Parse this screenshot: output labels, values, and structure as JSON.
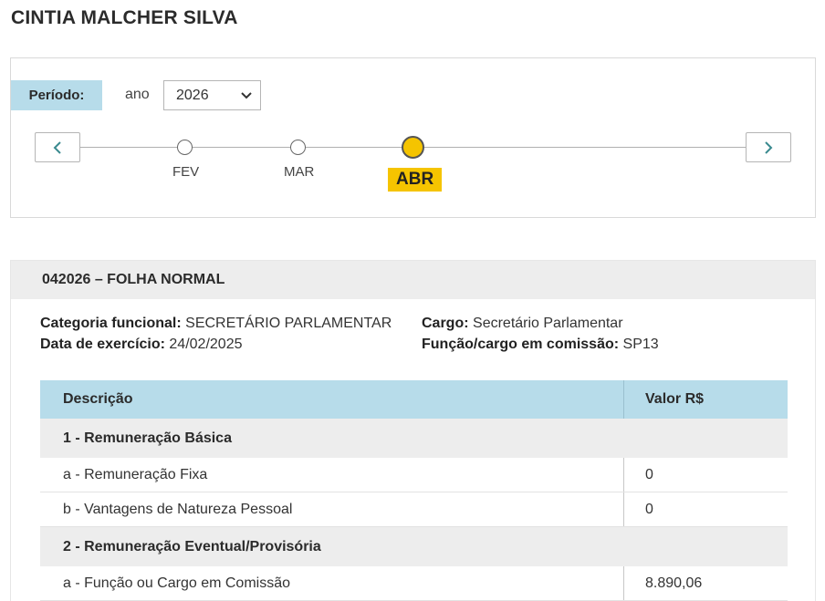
{
  "page": {
    "title": "CINTIA MALCHER SILVA"
  },
  "periodo": {
    "label": "Período:",
    "ano_label": "ano",
    "year_selected": "2026",
    "months": [
      {
        "label": "FEV",
        "selected": false
      },
      {
        "label": "MAR",
        "selected": false
      },
      {
        "label": "ABR",
        "selected": true
      }
    ],
    "prev_icon": "chevron-left-icon",
    "next_icon": "chevron-right-icon"
  },
  "folha": {
    "title": "042026 – FOLHA NORMAL",
    "categoria_label": "Categoria funcional:",
    "categoria_value": "SECRETÁRIO PARLAMENTAR",
    "data_label": "Data de exercício:",
    "data_value": "24/02/2025",
    "cargo_label": "Cargo:",
    "cargo_value": "Secretário Parlamentar",
    "funcao_label": "Função/cargo em comissão:",
    "funcao_value": "SP13"
  },
  "table": {
    "headers": [
      "Descrição",
      "Valor R$"
    ],
    "groups": [
      {
        "title": "1 - Remuneração Básica",
        "items": [
          {
            "desc": "a - Remuneração Fixa",
            "valor": "0"
          },
          {
            "desc": "b - Vantagens de Natureza Pessoal",
            "valor": "0"
          }
        ]
      },
      {
        "title": "2 - Remuneração Eventual/Provisória",
        "items": [
          {
            "desc": "a - Função ou Cargo em Comissão",
            "valor": "8.890,06"
          }
        ]
      }
    ]
  },
  "colors": {
    "accent_blue": "#b7dcea",
    "selected_month": "#f5c400",
    "gray_band": "#ededed"
  }
}
